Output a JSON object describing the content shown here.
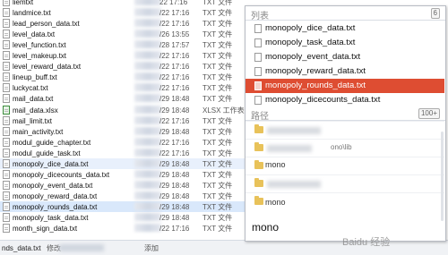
{
  "files": [
    {
      "name": "liemtxt",
      "date": "22 17:16",
      "type": "TXT 文件"
    },
    {
      "name": "landmice.txt",
      "date": "/22 17:16",
      "type": "TXT 文件"
    },
    {
      "name": "lead_person_data.txt",
      "date": "/22 17:16",
      "type": "TXT 文件"
    },
    {
      "name": "level_data.txt",
      "date": "/26 13:55",
      "type": "TXT 文件"
    },
    {
      "name": "level_function.txt",
      "date": "/28 17:57",
      "type": "TXT 文件"
    },
    {
      "name": "level_makeup.txt",
      "date": "/22 17:16",
      "type": "TXT 文件"
    },
    {
      "name": "level_reward_data.txt",
      "date": "/22 17:16",
      "type": "TXT 文件"
    },
    {
      "name": "lineup_buff.txt",
      "date": "/22 17:16",
      "type": "TXT 文件"
    },
    {
      "name": "luckycat.txt",
      "date": "/22 17:16",
      "type": "TXT 文件"
    },
    {
      "name": "mail_data.txt",
      "date": "/29 18:48",
      "type": "TXT 文件"
    },
    {
      "name": "mail_data.xlsx",
      "date": "/29 18:48",
      "type": "XLSX 工作表"
    },
    {
      "name": "mail_limit.txt",
      "date": "/22 17:16",
      "type": "TXT 文件"
    },
    {
      "name": "main_activity.txt",
      "date": "/29 18:48",
      "type": "TXT 文件"
    },
    {
      "name": "modul_guide_chapter.txt",
      "date": "/22 17:16",
      "type": "TXT 文件"
    },
    {
      "name": "modul_guide_task.txt",
      "date": "/22 17:16",
      "type": "TXT 文件"
    },
    {
      "name": "monopoly_dice_data.txt",
      "date": "/29 18:48",
      "type": "TXT 文件"
    },
    {
      "name": "monopoly_dicecounts_data.txt",
      "date": "/29 18:48",
      "type": "TXT 文件"
    },
    {
      "name": "monopoly_event_data.txt",
      "date": "/29 18:48",
      "type": "TXT 文件"
    },
    {
      "name": "monopoly_reward_data.txt",
      "date": "/29 18:48",
      "type": "TXT 文件"
    },
    {
      "name": "monopoly_rounds_data.txt",
      "date": "/29 18:48",
      "type": "TXT 文件"
    },
    {
      "name": "monopoly_task_data.txt",
      "date": "/29 18:48",
      "type": "TXT 文件"
    },
    {
      "name": "month_sign_data.txt",
      "date": "/22 17:16",
      "type": "TXT 文件"
    }
  ],
  "statusbar": {
    "filename": "nds_data.txt",
    "modified": "修改",
    "added": "添加"
  },
  "popup": {
    "list_title": "列表",
    "list_badge": "6",
    "items": [
      {
        "label": "monopoly_dice_data.txt"
      },
      {
        "label": "monopoly_task_data.txt"
      },
      {
        "label": "monopoly_event_data.txt"
      },
      {
        "label": "monopoly_reward_data.txt"
      },
      {
        "label": "monopoly_rounds_data.txt"
      },
      {
        "label": "monopoly_dicecounts_data.txt"
      }
    ],
    "path_title": "路径",
    "path_badge": "100+",
    "path_fragment": "ono\\lib",
    "mono_small_1": "mono",
    "mono_small_2": "mono",
    "mono_big": "mono"
  },
  "watermark": "Baidu 经验",
  "colors": {
    "accent": "#de4d32",
    "selection": "#d9e8fb"
  }
}
